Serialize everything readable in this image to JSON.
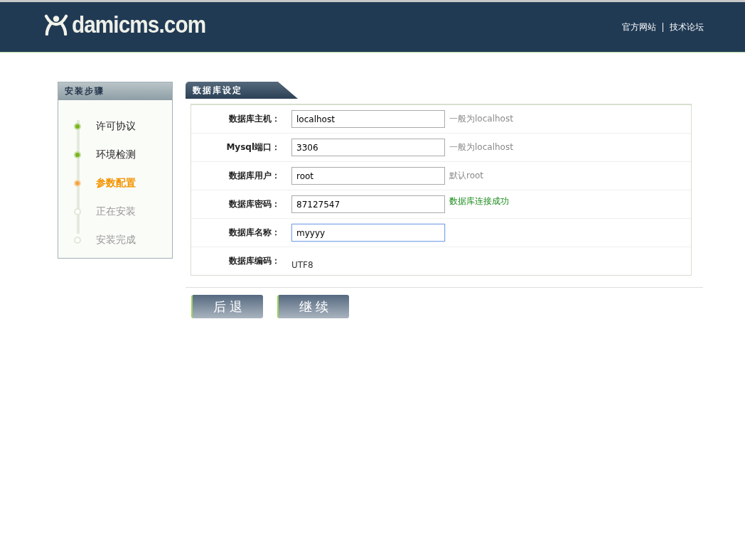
{
  "header": {
    "logo": "damicms.com",
    "links": [
      "官方网站",
      "技术论坛"
    ]
  },
  "sidebar": {
    "title": "安装步骤",
    "steps": [
      {
        "label": "许可协议",
        "kind": "done"
      },
      {
        "label": "环境检测",
        "kind": "done"
      },
      {
        "label": "参数配置",
        "kind": "current"
      },
      {
        "label": "正在安装",
        "kind": "pending"
      },
      {
        "label": "安装完成",
        "kind": "pending"
      }
    ]
  },
  "section": {
    "title": "数据库设定",
    "rows": [
      {
        "label": "数据库主机：",
        "kind": "input",
        "value": "localhost",
        "focused": false,
        "note": {
          "kind": "hint",
          "text": "一般为localhost"
        }
      },
      {
        "label": "Mysql端口：",
        "kind": "input",
        "value": "3306",
        "focused": false,
        "note": {
          "kind": "hint",
          "text": "一般为localhost"
        }
      },
      {
        "label": "数据库用户：",
        "kind": "input",
        "value": "root",
        "focused": false,
        "note": {
          "kind": "hint",
          "text": "默认root"
        }
      },
      {
        "label": "数据库密码：",
        "kind": "input",
        "value": "87127547",
        "focused": false,
        "note": {
          "kind": "success",
          "text": "数据库连接成功"
        }
      },
      {
        "label": "数据库名称：",
        "kind": "input",
        "value": "myyyy",
        "focused": true
      },
      {
        "label": "数据库编码：",
        "kind": "text",
        "value": "UTF8"
      }
    ]
  },
  "buttons": [
    "后 退",
    "继 续"
  ]
}
